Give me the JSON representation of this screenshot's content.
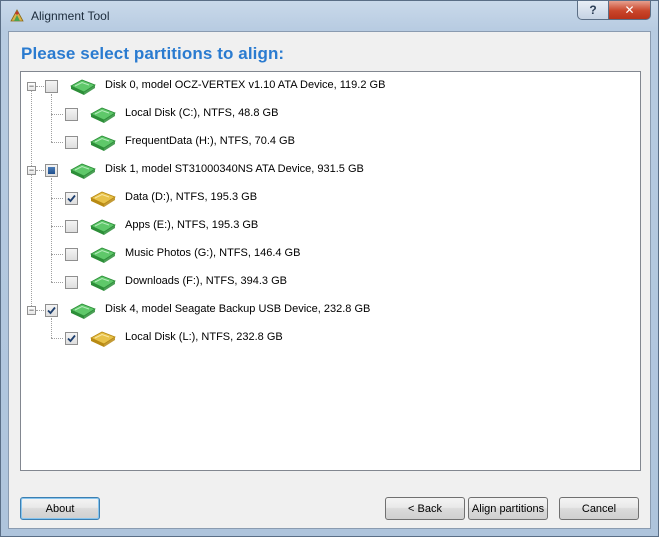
{
  "window": {
    "title": "Alignment Tool",
    "help_glyph": "?",
    "close_glyph": "✕"
  },
  "heading": "Please select partitions to align:",
  "tree": [
    {
      "label": "Disk 0, model OCZ-VERTEX v1.10 ATA Device, 119.2 GB",
      "check": "unchecked",
      "type": "disk",
      "color": "green",
      "children": [
        {
          "label": "Local Disk (C:), NTFS, 48.8 GB",
          "check": "unchecked",
          "color": "green"
        },
        {
          "label": "FrequentData (H:), NTFS, 70.4 GB",
          "check": "unchecked",
          "color": "green"
        }
      ]
    },
    {
      "label": "Disk 1, model ST31000340NS ATA Device, 931.5 GB",
      "check": "indeterminate",
      "type": "disk",
      "color": "green",
      "children": [
        {
          "label": "Data (D:), NTFS, 195.3 GB",
          "check": "checked",
          "color": "gold"
        },
        {
          "label": "Apps (E:), NTFS, 195.3 GB",
          "check": "unchecked",
          "color": "green"
        },
        {
          "label": "Music Photos (G:), NTFS, 146.4 GB",
          "check": "unchecked",
          "color": "green"
        },
        {
          "label": "Downloads (F:), NTFS, 394.3 GB",
          "check": "unchecked",
          "color": "green"
        }
      ]
    },
    {
      "label": "Disk 4, model Seagate Backup USB Device, 232.8 GB",
      "check": "checked",
      "type": "disk",
      "color": "green",
      "children": [
        {
          "label": "Local Disk (L:), NTFS, 232.8 GB",
          "check": "checked",
          "color": "gold"
        }
      ]
    }
  ],
  "buttons": {
    "about": "About",
    "back": "< Back",
    "align": "Align partitions",
    "cancel": "Cancel"
  },
  "colors": {
    "heading": "#2a7bd0",
    "drive_green": "#3fae49",
    "drive_gold": "#d4a82a",
    "checkbox_fill": "#2b5c9b"
  }
}
